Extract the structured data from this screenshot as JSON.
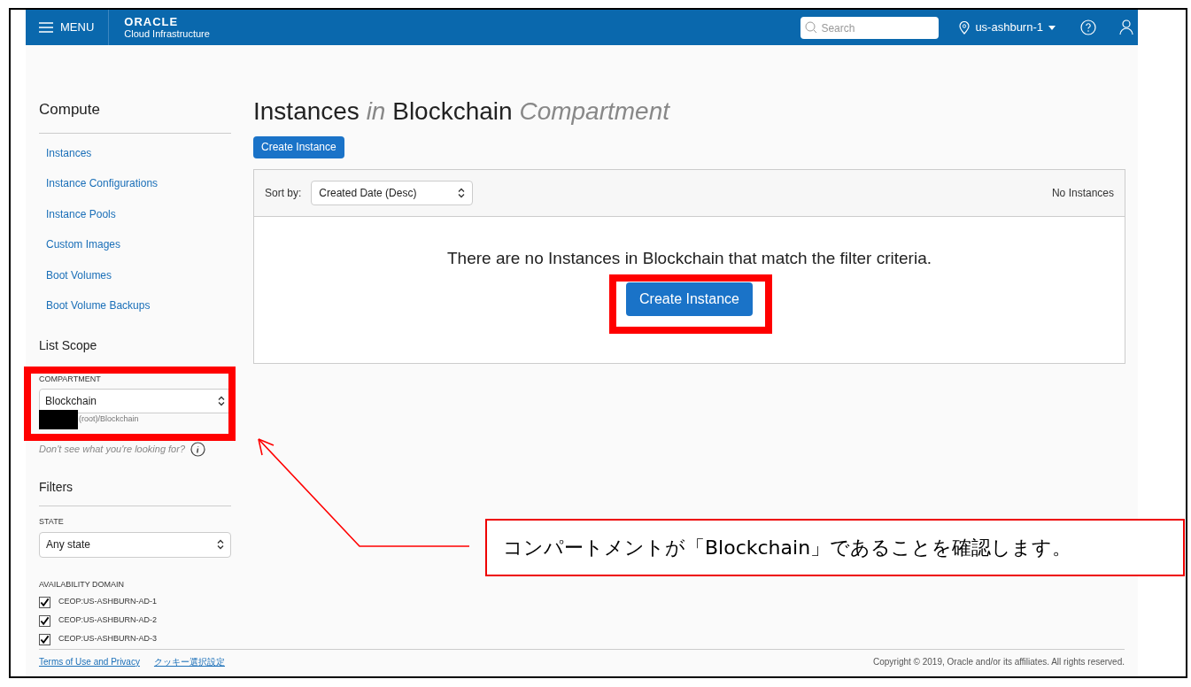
{
  "header": {
    "menu_label": "MENU",
    "logo_title": "ORACLE",
    "logo_subtitle": "Cloud Infrastructure",
    "search": {
      "placeholder": "Search"
    },
    "region": "us-ashburn-1"
  },
  "sidebar": {
    "title": "Compute",
    "items": [
      {
        "label": "Instances"
      },
      {
        "label": "Instance Configurations"
      },
      {
        "label": "Instance Pools"
      },
      {
        "label": "Custom Images"
      },
      {
        "label": "Boot Volumes"
      },
      {
        "label": "Boot Volume Backups"
      }
    ],
    "list_scope": {
      "title": "List Scope",
      "compartment": {
        "label": "COMPARTMENT",
        "value": "Blockchain",
        "path": "(root)/Blockchain"
      },
      "help_text": "Don't see what you're looking for?"
    },
    "filters": {
      "title": "Filters",
      "state": {
        "label": "STATE",
        "value": "Any state"
      },
      "availability_domain": {
        "label": "AVAILABILITY DOMAIN",
        "options": [
          {
            "label": "CEOP:US-ASHBURN-AD-1",
            "checked": true
          },
          {
            "label": "CEOP:US-ASHBURN-AD-2",
            "checked": true
          },
          {
            "label": "CEOP:US-ASHBURN-AD-3",
            "checked": true
          }
        ]
      }
    }
  },
  "main": {
    "title": [
      {
        "text": "Instances",
        "kind": "plain"
      },
      {
        "text": "in",
        "kind": "muted"
      },
      {
        "text": "Blockchain",
        "kind": "plain"
      },
      {
        "text": "Compartment",
        "kind": "muted"
      }
    ],
    "create_button": "Create Instance",
    "sort_label": "Sort by:",
    "sort_value": "Created Date (Desc)",
    "count": "No Instances",
    "empty_message": "There are no Instances in Blockchain that match the filter criteria.",
    "empty_button": "Create Instance"
  },
  "footer": {
    "links": [
      "Terms of Use and Privacy",
      "クッキー選択設定"
    ],
    "copyright": "Copyright © 2019, Oracle and/or its affiliates. All rights reserved."
  },
  "annotation": {
    "callout": "コンパートメントが「Blockchain」であることを確認します。"
  }
}
